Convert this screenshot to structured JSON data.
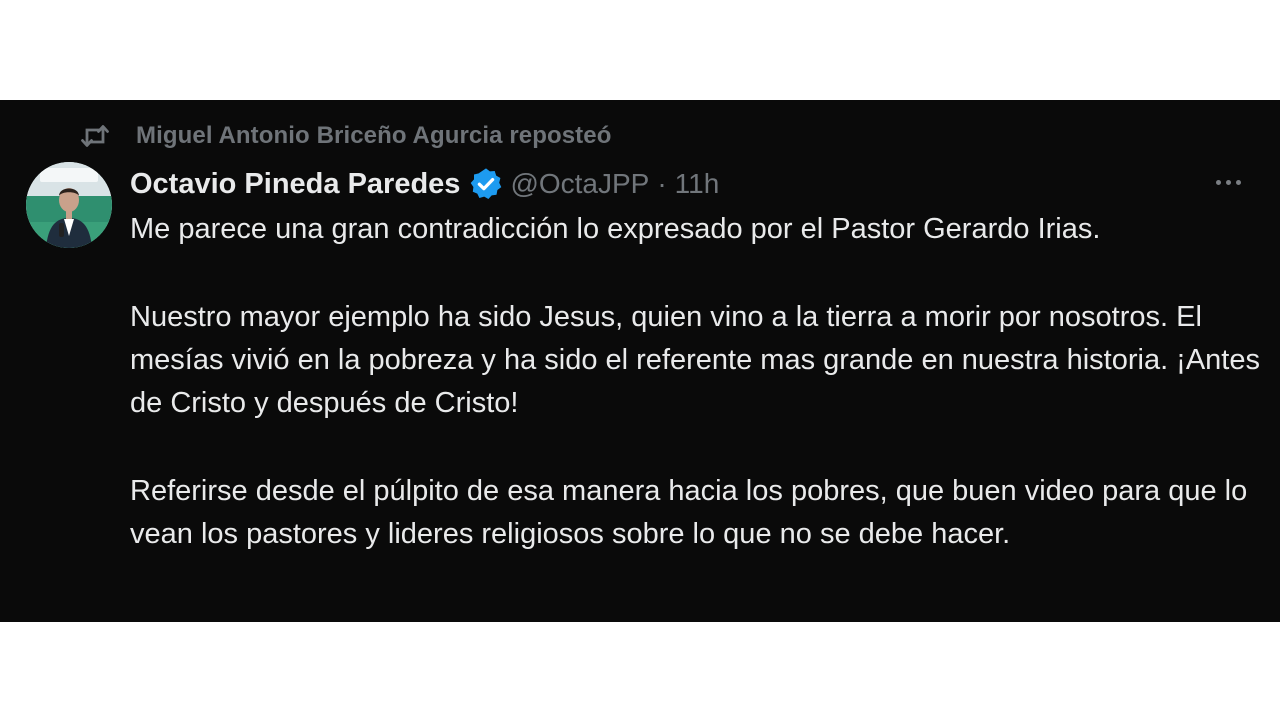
{
  "repost": {
    "icon": "repost-icon",
    "text": "Miguel Antonio Briceño Agurcia reposteó"
  },
  "author": {
    "avatar": "avatar",
    "name": "Octavio Pineda Paredes",
    "verified_icon": "verified-badge-icon",
    "handle": "@OctaJPP",
    "separator": "·",
    "time": "11h"
  },
  "more_icon": "more-options-icon",
  "body": {
    "paragraphs": [
      "Me parece una gran contradicción lo expresado por el Pastor Gerardo Irias.",
      "Nuestro mayor ejemplo ha sido Jesus, quien vino a la tierra a morir por nosotros. El mesías vivió en la pobreza y ha sido el referente mas grande en nuestra historia. ¡Antes de Cristo y después de Cristo!",
      "Referirse desde el púlpito de esa manera hacia los pobres, que buen video para que lo vean los pastores y lideres religiosos sobre lo que no se debe hacer."
    ]
  },
  "colors": {
    "panel_bg": "#0a0a0a",
    "text": "#e9eaeb",
    "muted": "#71767b",
    "verified_blue": "#1d9bf0"
  }
}
